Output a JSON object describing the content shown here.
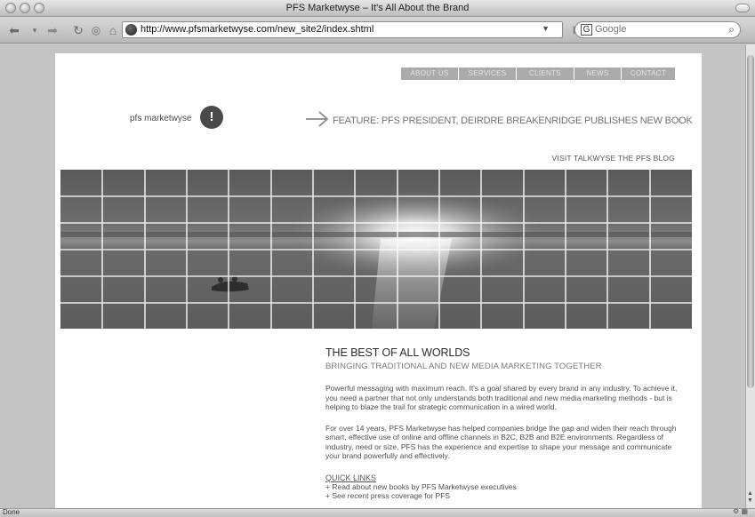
{
  "window": {
    "title": "PFS Marketwyse – It's All About the Brand"
  },
  "toolbar": {
    "url": "http://www.pfsmarketwyse.com/new_site2/index.shtml",
    "search_placeholder": "Google",
    "search_engine_letter": "G"
  },
  "nav": {
    "items": [
      "ABOUT US",
      "SERVICES",
      "CLIENTS",
      "NEWS",
      "CONTACT"
    ]
  },
  "header": {
    "brand": "pfs marketwyse",
    "brand_mark": "!",
    "feature": "FEATURE: PFS PRESIDENT, DEIRDRE BREAKENRIDGE PUBLISHES NEW BOOK",
    "blog_link": "VISIT TALKWYSE THE PFS BLOG"
  },
  "content": {
    "heading": "THE BEST OF ALL WORLDS",
    "subheading": "BRINGING TRADITIONAL AND NEW MEDIA MARKETING TOGETHER",
    "paragraph1": "Powerful messaging with maximum reach. It's a goal shared by every brand in any industry. To achieve it, you need a partner that not only understands both traditional and new media marketing methods - but is helping to blaze the trail for strategic communication in a wired world.",
    "paragraph2": "For over 14 years, PFS Marketwyse has helped companies bridge the gap and widen their reach through smart, effective use of online and offline channels in B2C, B2B and B2E environments. Regardless of industry, need or size, PFS has the experience and expertise to shape your message and communicate your brand powerfully and effectively.",
    "quick_links_title": "QUICK LINKS",
    "quick_links": [
      "+ Read about new books by PFS Marketwyse executives",
      "+ See recent press coverage for PFS"
    ]
  },
  "status": {
    "text": "Done"
  },
  "colors": {
    "nav_bg": "#ababab",
    "brand_mark_bg": "#4a4a4a",
    "page_bg": "#ffffff",
    "chrome_bg": "#c4c4c4"
  }
}
